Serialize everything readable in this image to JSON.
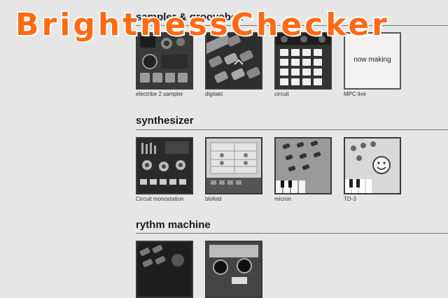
{
  "logo": {
    "text": "BrightnessChecker",
    "color": "#ff6a13"
  },
  "sections": [
    {
      "title": "sampler & groovebox",
      "items": [
        {
          "caption": "electribe 2 sampler",
          "image": "electribe-2-sampler-photo"
        },
        {
          "caption": "digitakt",
          "image": "digitakt-photo"
        },
        {
          "caption": "circuit",
          "image": "circuit-photo"
        },
        {
          "caption": "MPC live",
          "image": "placeholder",
          "placeholder_text": "now making"
        }
      ]
    },
    {
      "title": "synthesizer",
      "items": [
        {
          "caption": "Circuit monostation",
          "image": "circuit-monostation-photo"
        },
        {
          "caption": "blofeld",
          "image": "blofeld-photo"
        },
        {
          "caption": "micron",
          "image": "micron-photo"
        },
        {
          "caption": "TD-3",
          "image": "td-3-photo"
        }
      ]
    },
    {
      "title": "rythm machine",
      "items": [
        {
          "caption": "",
          "image": "rhythm-machine-1-photo"
        },
        {
          "caption": "",
          "image": "rhythm-machine-2-photo"
        }
      ]
    }
  ]
}
